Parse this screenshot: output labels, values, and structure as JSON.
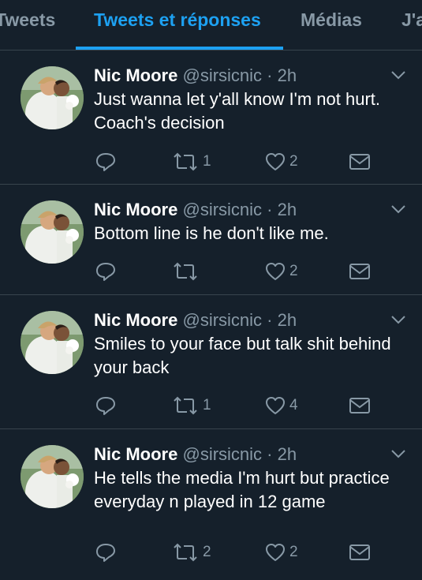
{
  "tabs": [
    {
      "label": "Tweets"
    },
    {
      "label": "Tweets et réponses"
    },
    {
      "label": "Médias"
    },
    {
      "label": "J'aime"
    }
  ],
  "colors": {
    "background": "#15202b",
    "accent": "#1da1f2",
    "muted": "#8899a6",
    "divider": "#38444d"
  },
  "tweets": [
    {
      "author": "Nic Moore",
      "handle": "@sirsicnic",
      "separator": "·",
      "time": "2h",
      "text": "Just wanna let y'all know I'm not hurt. Coach's decision",
      "retweets": "1",
      "likes": "2"
    },
    {
      "author": "Nic Moore",
      "handle": "@sirsicnic",
      "separator": "·",
      "time": "2h",
      "text": "Bottom line is he don't like me.",
      "retweets": "",
      "likes": "2"
    },
    {
      "author": "Nic Moore",
      "handle": "@sirsicnic",
      "separator": "·",
      "time": "2h",
      "text": "Smiles to your face but talk shit behind your back",
      "retweets": "1",
      "likes": "4"
    },
    {
      "author": "Nic Moore",
      "handle": "@sirsicnic",
      "separator": "·",
      "time": "2h",
      "text": "He tells the media I'm hurt but practice everyday n played in 12 game",
      "retweets": "2",
      "likes": "2"
    }
  ],
  "icons": {
    "reply": "reply-icon",
    "retweet": "retweet-icon",
    "like": "heart-icon",
    "message": "envelope-icon",
    "more": "chevron-down-icon"
  }
}
